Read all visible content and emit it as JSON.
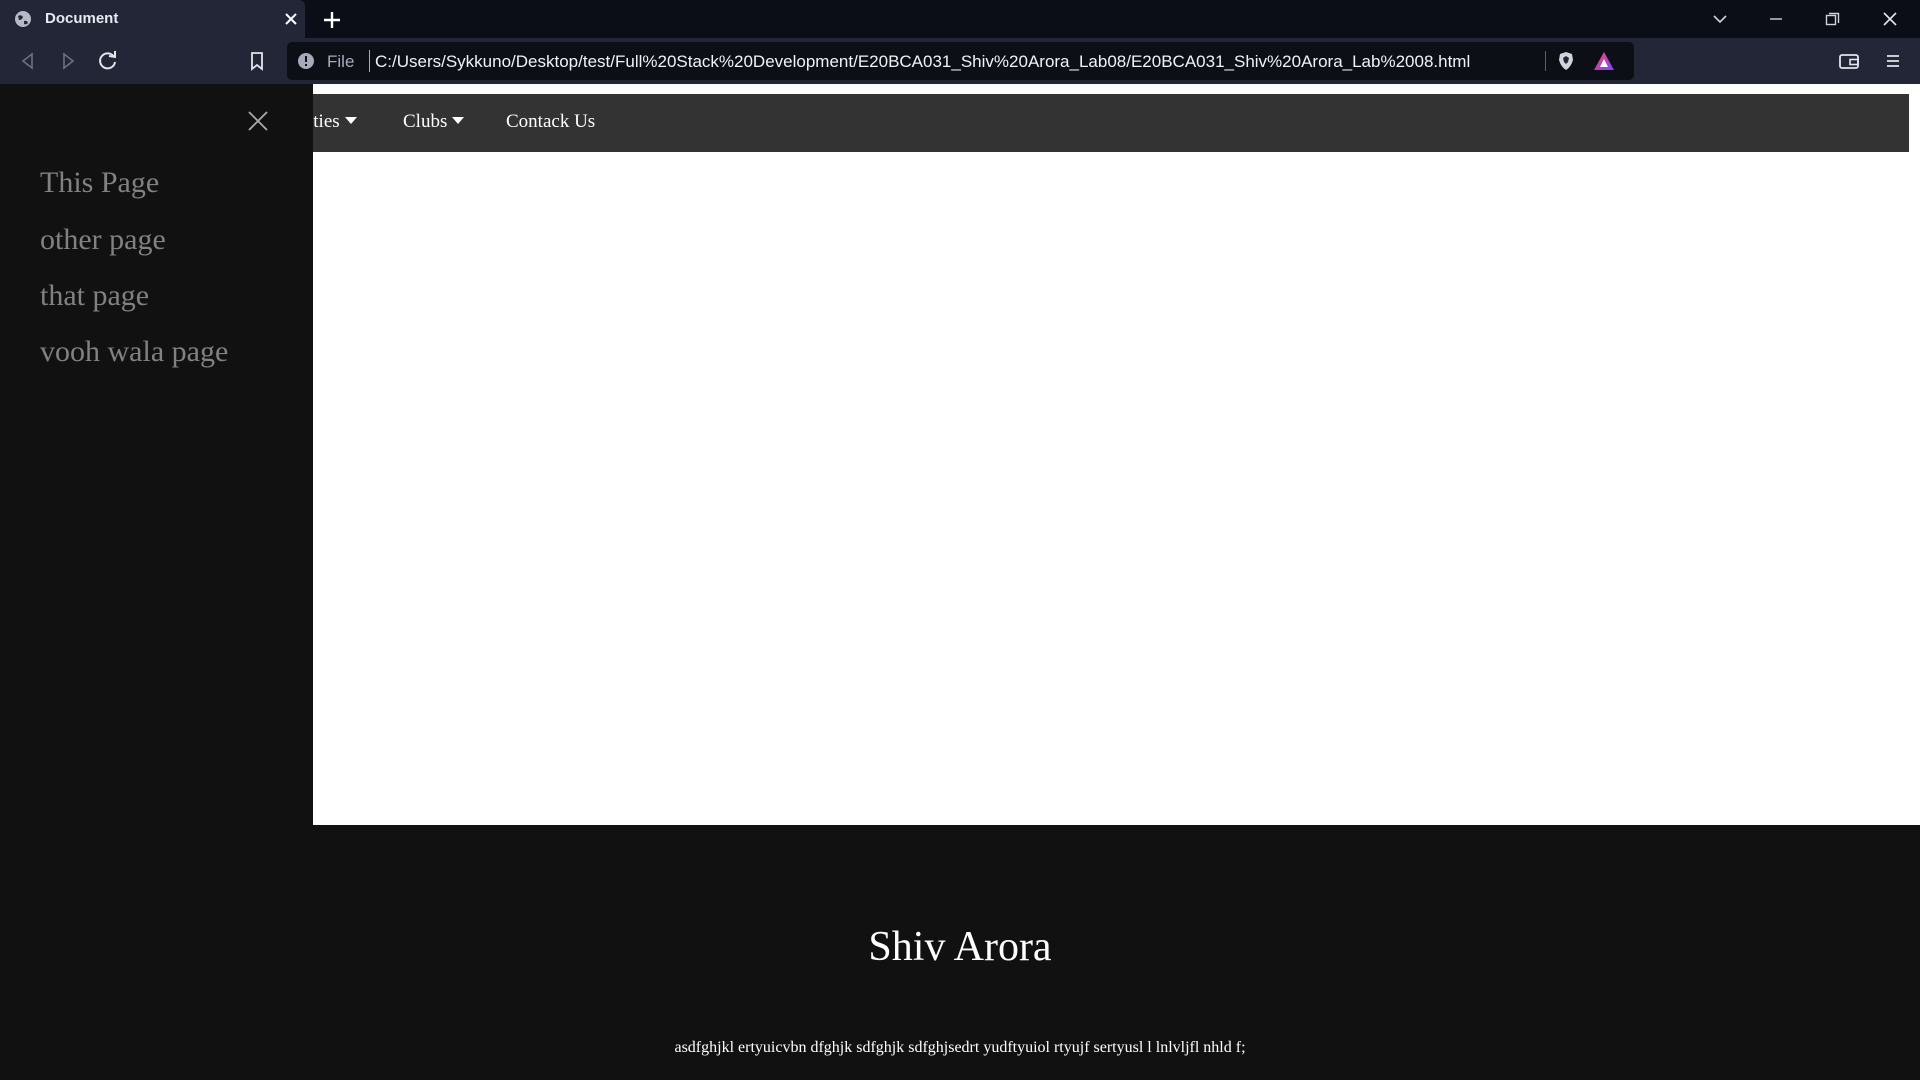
{
  "browser": {
    "tab_title": "Document",
    "url_scheme": "File",
    "url": "C:/Users/Sykkuno/Desktop/test/Full%20Stack%20Development/E20BCA031_Shiv%20Arora_Lab08/E20BCA031_Shiv%20Arora_Lab%2008.html",
    "icons": [
      "globe-icon",
      "close-icon",
      "plus-icon",
      "chevron-down-icon",
      "minimize-icon",
      "restore-icon",
      "window-close-icon",
      "back-icon",
      "forward-icon",
      "reload-icon",
      "bookmark-icon",
      "info-icon",
      "brave-shield-icon",
      "brave-rewards-icon",
      "wallet-icon",
      "menu-icon"
    ]
  },
  "navbar": {
    "items": [
      {
        "label": "ities",
        "dropdown": true
      },
      {
        "label": "Clubs",
        "dropdown": true
      },
      {
        "label": "Contack Us",
        "dropdown": false
      }
    ]
  },
  "sidenav": {
    "close_icon": "close-icon",
    "links": [
      "This Page",
      "other page",
      "that page",
      "vooh wala page"
    ]
  },
  "footer": {
    "name": "Shiv Arora",
    "text": "asdfghjkl ertyuicvbn dfghjk sdfghjk sdfghjsedrt yudftyuiol rtyujf sertyusl l lnlvljfl nhld f;"
  },
  "colors": {
    "navbar_bg": "#333333",
    "sidenav_bg": "#111111",
    "sidenav_link": "#818181",
    "footer_bg": "#111111",
    "chrome_dark": "#0b0d17",
    "chrome_toolbar": "#222637"
  }
}
